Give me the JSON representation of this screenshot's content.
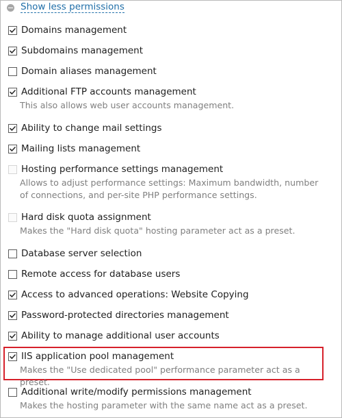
{
  "toggle": {
    "label": "Show less permissions",
    "icon": "collapse-circle-minus"
  },
  "permissions": [
    {
      "id": "domains",
      "label": "Domains management",
      "checked": true,
      "disabled": false,
      "description": ""
    },
    {
      "id": "subdomains",
      "label": "Subdomains management",
      "checked": true,
      "disabled": false,
      "description": ""
    },
    {
      "id": "domain-aliases",
      "label": "Domain aliases management",
      "checked": false,
      "disabled": false,
      "description": ""
    },
    {
      "id": "ftp-accounts",
      "label": "Additional FTP accounts management",
      "checked": true,
      "disabled": false,
      "description": "This also allows web user accounts management."
    },
    {
      "id": "mail-settings",
      "label": "Ability to change mail settings",
      "checked": true,
      "disabled": false,
      "description": ""
    },
    {
      "id": "mailing-lists",
      "label": "Mailing lists management",
      "checked": true,
      "disabled": false,
      "description": ""
    },
    {
      "id": "hosting-performance",
      "label": "Hosting performance settings management",
      "checked": false,
      "disabled": true,
      "description": "Allows to adjust performance settings: Maximum bandwidth, number of connections, and per-site PHP performance settings."
    },
    {
      "id": "hard-disk-quota",
      "label": "Hard disk quota assignment",
      "checked": false,
      "disabled": true,
      "description": "Makes the \"Hard disk quota\" hosting parameter act as a preset."
    },
    {
      "id": "db-server-selection",
      "label": "Database server selection",
      "checked": false,
      "disabled": false,
      "description": ""
    },
    {
      "id": "db-remote-access",
      "label": "Remote access for database users",
      "checked": false,
      "disabled": false,
      "description": ""
    },
    {
      "id": "advanced-operations",
      "label": "Access to advanced operations: Website Copying",
      "checked": true,
      "disabled": false,
      "description": ""
    },
    {
      "id": "protected-dirs",
      "label": "Password-protected directories management",
      "checked": true,
      "disabled": false,
      "description": ""
    },
    {
      "id": "user-accounts",
      "label": "Ability to manage additional user accounts",
      "checked": true,
      "disabled": false,
      "description": ""
    },
    {
      "id": "iis-app-pool",
      "label": "IIS application pool management",
      "checked": true,
      "disabled": false,
      "description": "Makes the \"Use dedicated pool\" performance parameter act as a preset."
    },
    {
      "id": "write-modify",
      "label": "Additional write/modify permissions management",
      "checked": false,
      "disabled": false,
      "description": "Makes the hosting parameter with the same name act as a preset."
    }
  ],
  "colors": {
    "link": "#1f6ea8",
    "description": "#7f7f7f",
    "highlight_border": "#d6202a"
  }
}
